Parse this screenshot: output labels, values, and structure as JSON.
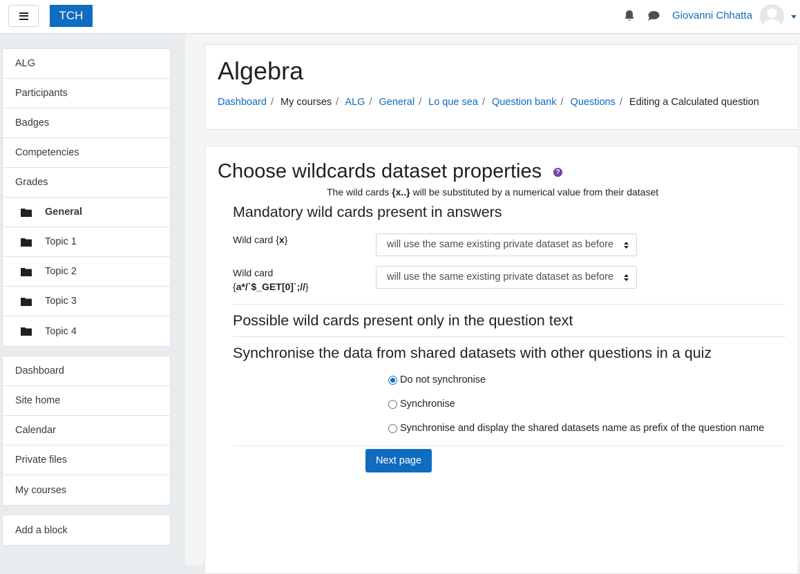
{
  "navbar": {
    "brand": "TCH",
    "user_name": "Giovanni Chhatta",
    "icons": [
      "hamburger-icon",
      "bell-icon",
      "chat-icon",
      "avatar",
      "caret-down-icon"
    ]
  },
  "sidebar": {
    "course_items": [
      {
        "label": "ALG"
      },
      {
        "label": "Participants"
      },
      {
        "label": "Badges"
      },
      {
        "label": "Competencies"
      },
      {
        "label": "Grades"
      },
      {
        "label": "General",
        "icon": "folder-icon"
      },
      {
        "label": "Topic 1",
        "icon": "folder-icon"
      },
      {
        "label": "Topic 2",
        "icon": "folder-icon"
      },
      {
        "label": "Topic 3",
        "icon": "folder-icon"
      },
      {
        "label": "Topic 4",
        "icon": "folder-icon"
      }
    ],
    "site_items": [
      {
        "label": "Dashboard"
      },
      {
        "label": "Site home"
      },
      {
        "label": "Calendar"
      },
      {
        "label": "Private files"
      },
      {
        "label": "My courses"
      }
    ],
    "add_block": "Add a block"
  },
  "header": {
    "title": "Algebra",
    "breadcrumb": [
      {
        "label": "Dashboard",
        "link": true
      },
      {
        "label": "My courses",
        "link": false
      },
      {
        "label": "ALG",
        "link": true
      },
      {
        "label": "General",
        "link": true
      },
      {
        "label": "Lo que sea",
        "link": true
      },
      {
        "label": "Question bank",
        "link": true
      },
      {
        "label": "Questions",
        "link": true
      },
      {
        "label": "Editing a Calculated question",
        "link": false
      }
    ]
  },
  "form": {
    "title": "Choose wildcards dataset properties",
    "help_icon": "?",
    "hint_prefix": "The wild cards ",
    "hint_bold": "{x..}",
    "hint_suffix": " will be substituted by a numerical value from their dataset",
    "mandatory_title": "Mandatory wild cards present in answers",
    "wildcard1_prefix": "Wild card ",
    "wildcard1_open": "{",
    "wildcard1_name": "x",
    "wildcard1_close": "}",
    "wildcard1_value": "will use the same existing private dataset as before",
    "wildcard2_prefix": "Wild card",
    "wildcard2_open": "{",
    "wildcard2_name": "a*/`$_GET[0]`;//",
    "wildcard2_close": "}",
    "wildcard2_value": "will use the same existing private dataset as before",
    "possible_title": "Possible wild cards present only in the question text",
    "sync_title": "Synchronise the data from shared datasets with other questions in a quiz",
    "sync_options": [
      {
        "label": "Do not synchronise",
        "checked": true
      },
      {
        "label": "Synchronise",
        "checked": false
      },
      {
        "label": "Synchronise and display the shared datasets name as prefix of the question name",
        "checked": false
      }
    ],
    "next_button": "Next page"
  },
  "colors": {
    "brand": "#0f6cbf",
    "help": "#7a3ea0"
  }
}
